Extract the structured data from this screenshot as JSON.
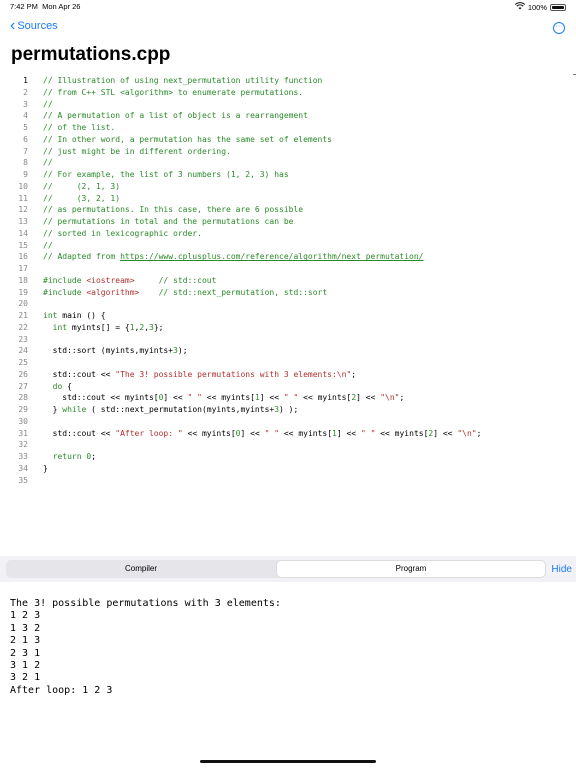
{
  "status": {
    "time": "7:42 PM",
    "date": "Mon Apr 26",
    "battery": "100%"
  },
  "nav": {
    "back_label": "Sources",
    "more_icon": "ellipsis-circle-icon"
  },
  "title": "permutations.cpp",
  "code_lines": [
    [
      {
        "t": "// Illustration of using next_permutation utility function",
        "c": "c"
      }
    ],
    [
      {
        "t": "// from C++ STL <algorithm> to enumerate permutations.",
        "c": "c"
      }
    ],
    [
      {
        "t": "//",
        "c": "c"
      }
    ],
    [
      {
        "t": "// A permutation of a list of object is a rearrangement",
        "c": "c"
      }
    ],
    [
      {
        "t": "// of the list.",
        "c": "c"
      }
    ],
    [
      {
        "t": "// In other word, a permutation has the same set of elements",
        "c": "c"
      }
    ],
    [
      {
        "t": "// just might be in different ordering.",
        "c": "c"
      }
    ],
    [
      {
        "t": "//",
        "c": "c"
      }
    ],
    [
      {
        "t": "// For example, the list of 3 numbers (1, 2, 3) has",
        "c": "c"
      }
    ],
    [
      {
        "t": "//     (2, 1, 3)",
        "c": "c"
      }
    ],
    [
      {
        "t": "//     (3, 2, 1)",
        "c": "c"
      }
    ],
    [
      {
        "t": "// as permutations. In this case, there are 6 possible",
        "c": "c"
      }
    ],
    [
      {
        "t": "// permutations in total and the permutations can be",
        "c": "c"
      }
    ],
    [
      {
        "t": "// sorted in lexicographic order.",
        "c": "c"
      }
    ],
    [
      {
        "t": "//",
        "c": "c"
      }
    ],
    [
      {
        "t": "// Adapted from ",
        "c": "c"
      },
      {
        "t": "https://www.cplusplus.com/reference/algorithm/next_permutation/",
        "c": "link"
      }
    ],
    [],
    [
      {
        "t": "#include ",
        "c": "kw"
      },
      {
        "t": "<iostream>",
        "c": "str"
      },
      {
        "t": "     // std::cout",
        "c": "c"
      }
    ],
    [
      {
        "t": "#include ",
        "c": "kw"
      },
      {
        "t": "<algorithm>",
        "c": "str"
      },
      {
        "t": "    // std::next_permutation, std::sort",
        "c": "c"
      }
    ],
    [],
    [
      {
        "t": "int",
        "c": "kw"
      },
      {
        "t": " main () {",
        "c": ""
      }
    ],
    [
      {
        "t": "  ",
        "c": ""
      },
      {
        "t": "int",
        "c": "kw"
      },
      {
        "t": " myints[] = {",
        "c": ""
      },
      {
        "t": "1",
        "c": "num"
      },
      {
        "t": ",",
        "c": ""
      },
      {
        "t": "2",
        "c": "num"
      },
      {
        "t": ",",
        "c": ""
      },
      {
        "t": "3",
        "c": "num"
      },
      {
        "t": "};",
        "c": ""
      }
    ],
    [],
    [
      {
        "t": "  std::sort (myints,myints+",
        "c": ""
      },
      {
        "t": "3",
        "c": "num"
      },
      {
        "t": ");",
        "c": ""
      }
    ],
    [],
    [
      {
        "t": "  std::cout << ",
        "c": ""
      },
      {
        "t": "\"The 3! possible permutations with 3 elements:\\n\"",
        "c": "str"
      },
      {
        "t": ";",
        "c": ""
      }
    ],
    [
      {
        "t": "  ",
        "c": ""
      },
      {
        "t": "do",
        "c": "kw"
      },
      {
        "t": " {",
        "c": ""
      }
    ],
    [
      {
        "t": "    std::cout << myints[",
        "c": ""
      },
      {
        "t": "0",
        "c": "num"
      },
      {
        "t": "] << ",
        "c": ""
      },
      {
        "t": "\" \"",
        "c": "str"
      },
      {
        "t": " << myints[",
        "c": ""
      },
      {
        "t": "1",
        "c": "num"
      },
      {
        "t": "] << ",
        "c": ""
      },
      {
        "t": "\" \"",
        "c": "str"
      },
      {
        "t": " << myints[",
        "c": ""
      },
      {
        "t": "2",
        "c": "num"
      },
      {
        "t": "] << ",
        "c": ""
      },
      {
        "t": "\"\\n\"",
        "c": "str"
      },
      {
        "t": ";",
        "c": ""
      }
    ],
    [
      {
        "t": "  } ",
        "c": ""
      },
      {
        "t": "while",
        "c": "kw"
      },
      {
        "t": " ( std::next_permutation(myints,myints+",
        "c": ""
      },
      {
        "t": "3",
        "c": "num"
      },
      {
        "t": ") );",
        "c": ""
      }
    ],
    [],
    [
      {
        "t": "  std::cout << ",
        "c": ""
      },
      {
        "t": "\"After loop: \"",
        "c": "str"
      },
      {
        "t": " << myints[",
        "c": ""
      },
      {
        "t": "0",
        "c": "num"
      },
      {
        "t": "] << ",
        "c": ""
      },
      {
        "t": "\" \"",
        "c": "str"
      },
      {
        "t": " << myints[",
        "c": ""
      },
      {
        "t": "1",
        "c": "num"
      },
      {
        "t": "] << ",
        "c": ""
      },
      {
        "t": "\" \"",
        "c": "str"
      },
      {
        "t": " << myints[",
        "c": ""
      },
      {
        "t": "2",
        "c": "num"
      },
      {
        "t": "] << ",
        "c": ""
      },
      {
        "t": "\"\\n\"",
        "c": "str"
      },
      {
        "t": ";",
        "c": ""
      }
    ],
    [],
    [
      {
        "t": "  ",
        "c": ""
      },
      {
        "t": "return",
        "c": "kw"
      },
      {
        "t": " ",
        "c": ""
      },
      {
        "t": "0",
        "c": "num"
      },
      {
        "t": ";",
        "c": ""
      }
    ],
    [
      {
        "t": "}",
        "c": ""
      }
    ],
    []
  ],
  "current_line": 1,
  "tabs": {
    "compiler": "Compiler",
    "program": "Program",
    "selected": "program"
  },
  "hide_label": "Hide",
  "output_lines": [
    "The 3! possible permutations with 3 elements:",
    "1 2 3",
    "1 3 2",
    "2 1 3",
    "2 3 1",
    "3 1 2",
    "3 2 1",
    "After loop: 1 2 3"
  ],
  "colors": {
    "accent": "#1a7cf5",
    "comment": "#2a8a2a",
    "string": "#b03030"
  }
}
